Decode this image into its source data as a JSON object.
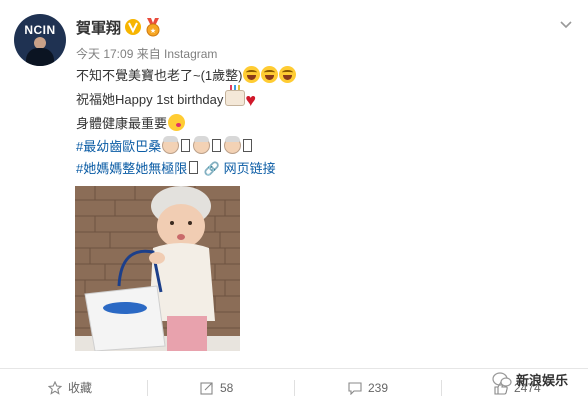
{
  "post": {
    "username": "賀軍翔",
    "avatar_text": "NCIN",
    "timestamp": "今天 17:09",
    "source": "来自 Instagram",
    "line1": "不知不覺美寶也老了~(1歲整)",
    "line2": "祝福她Happy 1st birthday",
    "line3": "身體健康最重要",
    "tag1": "#最幼齒歐巴桑",
    "tag2": "#她媽媽整她無極限",
    "link_label": "网页链接"
  },
  "actions": {
    "favorite": "收藏",
    "forward_count": "58",
    "comment_count": "239",
    "like_count": "2474"
  },
  "watermark": "新浪娱乐",
  "colors": {
    "link": "#0b5ca5",
    "text": "#333333",
    "meta": "#808080",
    "verified": "#f7b500"
  }
}
